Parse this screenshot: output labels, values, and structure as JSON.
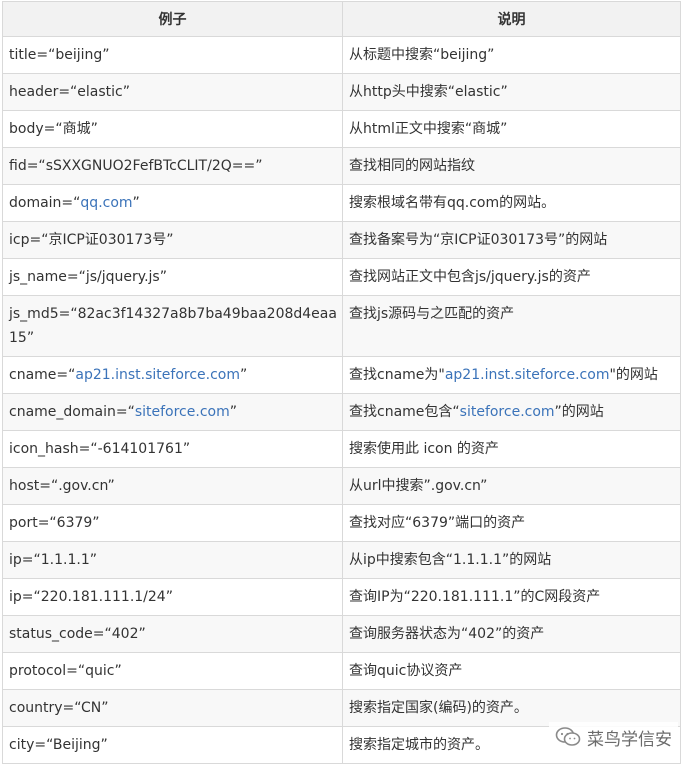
{
  "headers": {
    "example": "例子",
    "description": "说明"
  },
  "rows": [
    {
      "ex": [
        "title=“beijing”"
      ],
      "desc": [
        "从标题中搜索“beijing”"
      ]
    },
    {
      "ex": [
        "header=“elastic”"
      ],
      "desc": [
        "从http头中搜索“elastic”"
      ]
    },
    {
      "ex": [
        "body=“商城”"
      ],
      "desc": [
        "从html正文中搜索“商城”"
      ]
    },
    {
      "ex": [
        "fid=“sSXXGNUO2FefBTcCLIT/2Q==”"
      ],
      "desc": [
        "查找相同的网站指纹"
      ]
    },
    {
      "ex": [
        "domain=“",
        {
          "link": "qq.com"
        },
        "”"
      ],
      "desc": [
        "搜索根域名带有qq.com的网站。"
      ]
    },
    {
      "ex": [
        "icp=“京ICP证030173号”"
      ],
      "desc": [
        "查找备案号为“京ICP证030173号”的网站"
      ]
    },
    {
      "ex": [
        "js_name=“js/jquery.js”"
      ],
      "desc": [
        "查找网站正文中包含js/jquery.js的资产"
      ]
    },
    {
      "ex": [
        "js_md5=“82ac3f14327a8b7ba49baa208d4eaa15”"
      ],
      "desc": [
        "查找js源码与之匹配的资产"
      ],
      "tall": true
    },
    {
      "ex": [
        "cname=“",
        {
          "link": "ap21.inst.siteforce.com"
        },
        "”"
      ],
      "desc": [
        "查找cname为\"",
        {
          "link": "ap21.inst.siteforce.com"
        },
        "\"的网站"
      ]
    },
    {
      "ex": [
        "cname_domain=“",
        {
          "link": "siteforce.com"
        },
        "”"
      ],
      "desc": [
        "查找cname包含“",
        {
          "link": "siteforce.com"
        },
        "”的网站"
      ]
    },
    {
      "ex": [
        "icon_hash=“-614101761”"
      ],
      "desc": [
        "搜索使用此 icon 的资产"
      ]
    },
    {
      "ex": [
        "host=“.gov.cn”"
      ],
      "desc": [
        "从url中搜索”.gov.cn”"
      ]
    },
    {
      "ex": [
        "port=“6379”"
      ],
      "desc": [
        "查找对应“6379”端口的资产"
      ]
    },
    {
      "ex": [
        "ip=“1.1.1.1”"
      ],
      "desc": [
        "从ip中搜索包含“1.1.1.1”的网站"
      ]
    },
    {
      "ex": [
        "ip=“220.181.111.1/24”"
      ],
      "desc": [
        "查询IP为“220.181.111.1”的C网段资产"
      ]
    },
    {
      "ex": [
        "status_code=“402”"
      ],
      "desc": [
        "查询服务器状态为“402”的资产"
      ]
    },
    {
      "ex": [
        "protocol=“quic”"
      ],
      "desc": [
        "查询quic协议资产"
      ]
    },
    {
      "ex": [
        "country=“CN”"
      ],
      "desc": [
        "搜索指定国家(编码)的资产。"
      ]
    },
    {
      "ex": [
        "city=“Beijing”"
      ],
      "desc": [
        "搜索指定城市的资产。"
      ]
    }
  ],
  "watermark": {
    "text": "菜鸟学信安",
    "icon": "wechat-icon"
  },
  "colors": {
    "link": "#3b73b9",
    "header_bg": "#f2f2f2",
    "border": "#d9d9d9"
  }
}
